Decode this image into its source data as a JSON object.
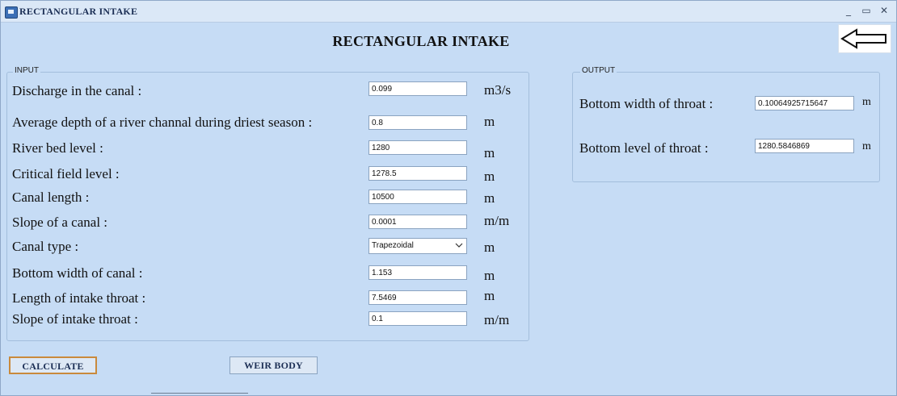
{
  "window": {
    "title": "RECTANGULAR INTAKE",
    "icon": "app-icon",
    "controls": {
      "minimize": "_",
      "maximize": "▭",
      "close": "✕"
    }
  },
  "header": {
    "title": "RECTANGULAR INTAKE",
    "back_icon": "left-arrow-icon"
  },
  "input": {
    "legend": "INPUT",
    "fields": {
      "discharge": {
        "label": "Discharge in the canal :",
        "value": "0.099",
        "unit": "m3/s"
      },
      "avg_depth": {
        "label": "Average depth of a river channal during driest season :",
        "value": "0.8",
        "unit": "m"
      },
      "river_bed": {
        "label": "River bed level :",
        "value": "1280",
        "unit": "m"
      },
      "critical_field": {
        "label": "Critical field level :",
        "value": "1278.5",
        "unit": "m"
      },
      "canal_length": {
        "label": "Canal length :",
        "value": "10500",
        "unit": "m"
      },
      "slope_canal": {
        "label": "Slope of a canal :",
        "value": "0.0001",
        "unit": "m/m"
      },
      "canal_type": {
        "label": "Canal type :",
        "value": "Trapezoidal",
        "unit": "m"
      },
      "bottom_width_canal": {
        "label": "Bottom width of canal :",
        "value": "1.153",
        "unit": "m"
      },
      "length_throat": {
        "label": "Length of intake throat :",
        "value": "7.5469",
        "unit": "m"
      },
      "slope_throat": {
        "label": "Slope of intake throat :",
        "value": "0.1",
        "unit": "m/m"
      }
    }
  },
  "output": {
    "legend": "OUTPUT",
    "fields": {
      "bottom_width_throat": {
        "label": "Bottom width of throat :",
        "value": "0.10064925715647",
        "unit": "m"
      },
      "bottom_level_throat": {
        "label": "Bottom level of throat :",
        "value": "1280.5846869",
        "unit": "m"
      }
    }
  },
  "buttons": {
    "calculate": "CALCULATE",
    "weir_body": "WEIR BODY"
  }
}
